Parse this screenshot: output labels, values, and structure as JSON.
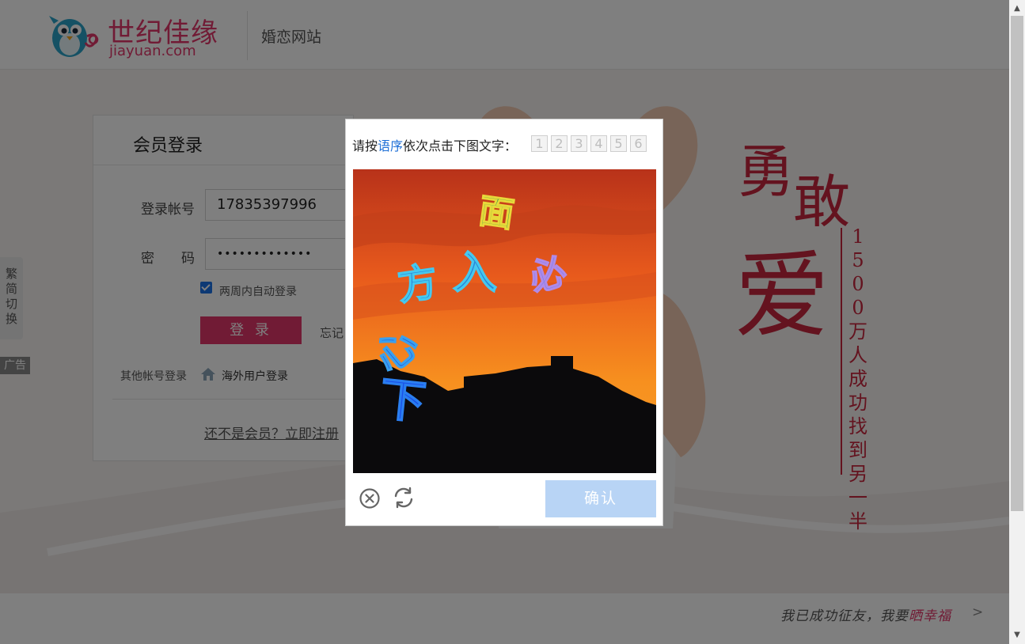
{
  "header": {
    "logo_cn": "世纪佳缘",
    "logo_en": "jiayuan.com",
    "site_name": "婚恋网站"
  },
  "banner": {
    "slogan_words": [
      "勇",
      "敢",
      "爱"
    ],
    "slogan_vertical": "1500万人成功找到另一半"
  },
  "login": {
    "title": "会员登录",
    "account_label": "登录帐号",
    "account_value": "17835397996",
    "password_label": "密　　码",
    "password_value": "•••••••••••••",
    "remember_checked": true,
    "remember_label": "两周内自动登录",
    "login_button": "登 录",
    "forgot_link": "忘记",
    "other_login_label": "其他帐号登录",
    "overseas_login": "海外用户登录",
    "register_link": "还不是会员？立即注册"
  },
  "side": {
    "lang_switch": "繁简切换",
    "ad_tag": "广告"
  },
  "footer": {
    "slogan_prefix": "我已成功征友，我要",
    "slogan_accent": "晒幸福",
    "chevron": ">"
  },
  "captcha": {
    "prompt_prefix": "请按",
    "prompt_highlight": "语序",
    "prompt_suffix": "依次点击下图文字：",
    "order_slots": [
      "1",
      "2",
      "3",
      "4",
      "5",
      "6"
    ],
    "image_chars": [
      "面",
      "方",
      "入",
      "必",
      "心",
      "下"
    ],
    "confirm_button": "确认"
  },
  "colors": {
    "brand": "#e2366a",
    "slogan_red": "#c8273e",
    "captcha_highlight": "#1e6fd6",
    "confirm_disabled": "#b8d4f5",
    "overlay": "rgba(0,0,0,0.5)"
  },
  "icons": {
    "logo": "bird-mascot-icon",
    "overseas": "globe-icon",
    "captcha_close": "close-circle-icon",
    "captcha_refresh": "refresh-icon"
  }
}
